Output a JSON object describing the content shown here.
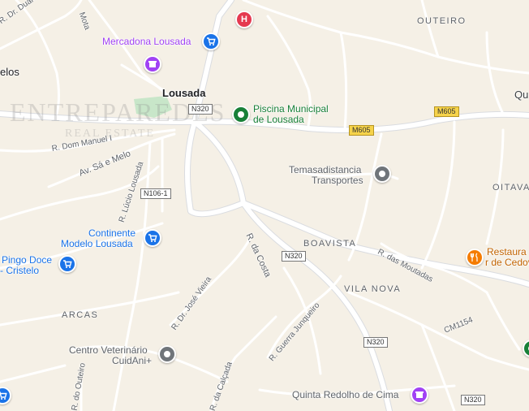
{
  "colors": {
    "land": "#f5f0e6",
    "road": "#ffffff",
    "road_edge": "#dadce0",
    "park": "#c8e6c9"
  },
  "places": {
    "outeiro": "OUTEIRO",
    "oitava": "OITAVA",
    "boavista": "BOAVISTA",
    "vila_nova": "VILA NOVA",
    "arcas": "ARCAS",
    "lousada": "Lousada",
    "melos": "elos",
    "qu": "Qu"
  },
  "pois": {
    "mercadona": "Mercadona Lousada",
    "piscina_1": "Piscina Municipal",
    "piscina_2": "de Lousada",
    "temas_1": "Temasadistancia",
    "temas_2": "Transportes",
    "continente_1": "Continente",
    "continente_2": "Modelo Lousada",
    "pingo_1": "Pingo Doce",
    "pingo_2": "- Cristelo",
    "centro_1": "Centro Veterinário",
    "centro_2": "CuidAni+",
    "quinta": "Quinta Redolho de Cima",
    "restaurant_1": "Restaura",
    "restaurant_2": "r de Cedov"
  },
  "roads": {
    "dom_manuel": "R. Dom Manuel I",
    "sa_melo": "Av. Sá e Melo",
    "lucio": "R. Lúcio Lousada",
    "da_costa": "R. da Costa",
    "das_moutadas": "R. das Moutadas",
    "jose_vieira": "R. Dr. José Vieira",
    "guerra": "R. Guerra Junqueiro",
    "da_calcada": "R. da Calçada",
    "dr_duarte": "R. Dr. Duarte",
    "mota": "Mota",
    "outeiro_rd": "R. do Outeiro",
    "cm1154": "CM1154"
  },
  "shields": {
    "n320_a": "N320",
    "n320_b": "N320",
    "n320_c": "N320",
    "n320_d": "N320",
    "n106": "N106-1",
    "m605_a": "M605",
    "m605_b": "M605"
  },
  "icons": {
    "shopping": "shopping-cart-icon",
    "store": "store-icon",
    "hospital": "hospital-icon",
    "place": "place-icon",
    "restaurant": "restaurant-icon"
  },
  "watermark": {
    "line1": "ENTREPAREDES",
    "line2": "REAL ESTATE"
  }
}
